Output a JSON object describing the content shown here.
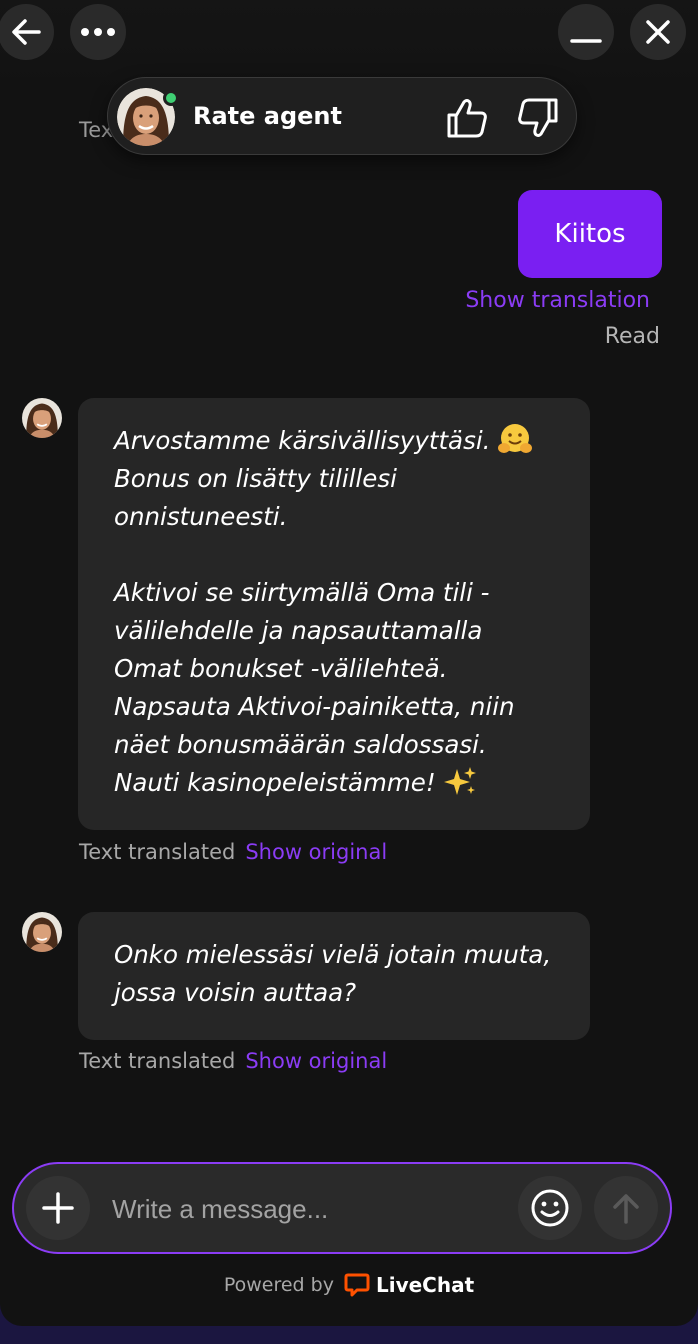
{
  "header": {
    "rate_label": "Rate agent",
    "peek_text": "Tex"
  },
  "user_message": {
    "text": "Kiitos",
    "show_translation": "Show translation",
    "status": "Read"
  },
  "agent_messages": [
    {
      "paragraph_1": "Arvostamme kärsivällisyyttäsi.",
      "paragraph_1b": "Bonus on lisätty tilillesi onnistuneesti.",
      "paragraph_2": "Aktivoi se siirtymällä Oma tili -välilehdelle ja napsauttamalla Omat bonukset -välilehteä. Napsauta Aktivoi-painiketta, niin näet bonusmäärän saldossasi. Nauti kasinopeleistämme!",
      "translated_label": "Text translated",
      "show_original": "Show original"
    },
    {
      "text": "Onko mielessäsi vielä jotain muuta, jossa voisin auttaa?",
      "translated_label": "Text translated",
      "show_original": "Show original"
    }
  ],
  "composer": {
    "placeholder": "Write a message..."
  },
  "footer": {
    "powered_by": "Powered by",
    "brand": "LiveChat"
  },
  "colors": {
    "accent": "#8b3cf5",
    "user_bubble": "#7a1ff2",
    "online": "#3fcf73",
    "brand_orange": "#ff5100"
  }
}
